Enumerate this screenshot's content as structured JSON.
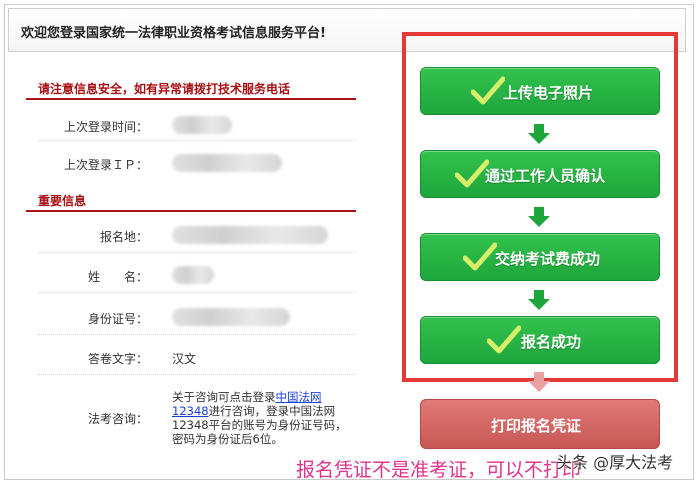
{
  "welcome": "欢迎您登录国家统一法律职业资格考试信息服务平台!",
  "security_notice": "请注意信息安全，如有异常请拨打技术服务电话",
  "last_login_time_label": "上次登录时间：",
  "last_login_ip_label": "上次登录ＩＰ：",
  "important_info": "重要信息",
  "fields": {
    "registration_place_label": "报名地：",
    "name_label": "姓　　名：",
    "id_number_label": "身份证号：",
    "answer_language_label": "答卷文字：",
    "answer_language_value": "汉文",
    "consult_label": "法考咨询："
  },
  "consult": {
    "prefix": "关于咨询可点击登录",
    "link1": "中国法网",
    "link2": "12348",
    "suffix": "进行咨询，登录中国法网12348平台的账号为身份证号码，密码为身份证后6位。"
  },
  "steps": [
    {
      "label": "上传电子照片"
    },
    {
      "label": "通过工作人员确认"
    },
    {
      "label": "交纳考试费成功"
    },
    {
      "label": "报名成功"
    }
  ],
  "print_button": "打印报名凭证",
  "caption": "报名凭证不是准考证，可以不打印",
  "watermark": "头条 @厚大法考",
  "colors": {
    "step_green": "#1ea63b",
    "highlight_red": "#e53935",
    "print_button": "#c85754",
    "caption_pink": "#e0338d",
    "section_red": "#a80f12"
  }
}
